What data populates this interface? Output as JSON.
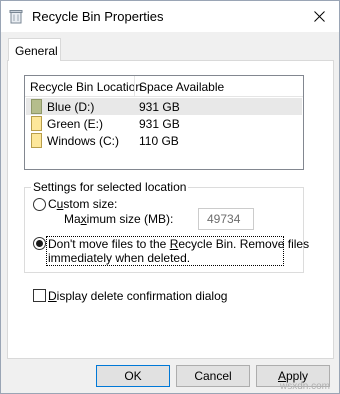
{
  "window": {
    "title": "Recycle Bin Properties"
  },
  "tabs": [
    {
      "label": "General"
    }
  ],
  "list": {
    "columns": [
      "Recycle Bin Location",
      "Space Available"
    ],
    "rows": [
      {
        "name": "Blue (D:)",
        "space": "931 GB",
        "selected": true
      },
      {
        "name": "Green (E:)",
        "space": "931 GB",
        "selected": false
      },
      {
        "name": "Windows (C:)",
        "space": "110 GB",
        "selected": false
      }
    ]
  },
  "settings": {
    "legend": "Settings for selected location",
    "custom": {
      "prefix": "C",
      "underlined": "u",
      "suffix": "stom size:"
    },
    "max": {
      "prefix": "Ma",
      "underlined": "x",
      "suffix": "imum size (MB):",
      "value": "49734"
    },
    "dont_move": {
      "line1_prefix": "Don't move files to the ",
      "line1_underlined": "R",
      "line1_suffix": "ecycle Bin. Remove files",
      "line2": "immediately when deleted."
    }
  },
  "confirm": {
    "prefix": "",
    "underlined": "D",
    "suffix": "isplay delete confirmation dialog"
  },
  "buttons": {
    "ok": "OK",
    "cancel": "Cancel",
    "apply_underlined": "A",
    "apply_suffix": "pply"
  },
  "watermark": "wsxdn.com",
  "colors": {
    "accent": "#0078d7",
    "drive_yellow": "#fde79a",
    "drive_dark": "#b5bd8c"
  }
}
